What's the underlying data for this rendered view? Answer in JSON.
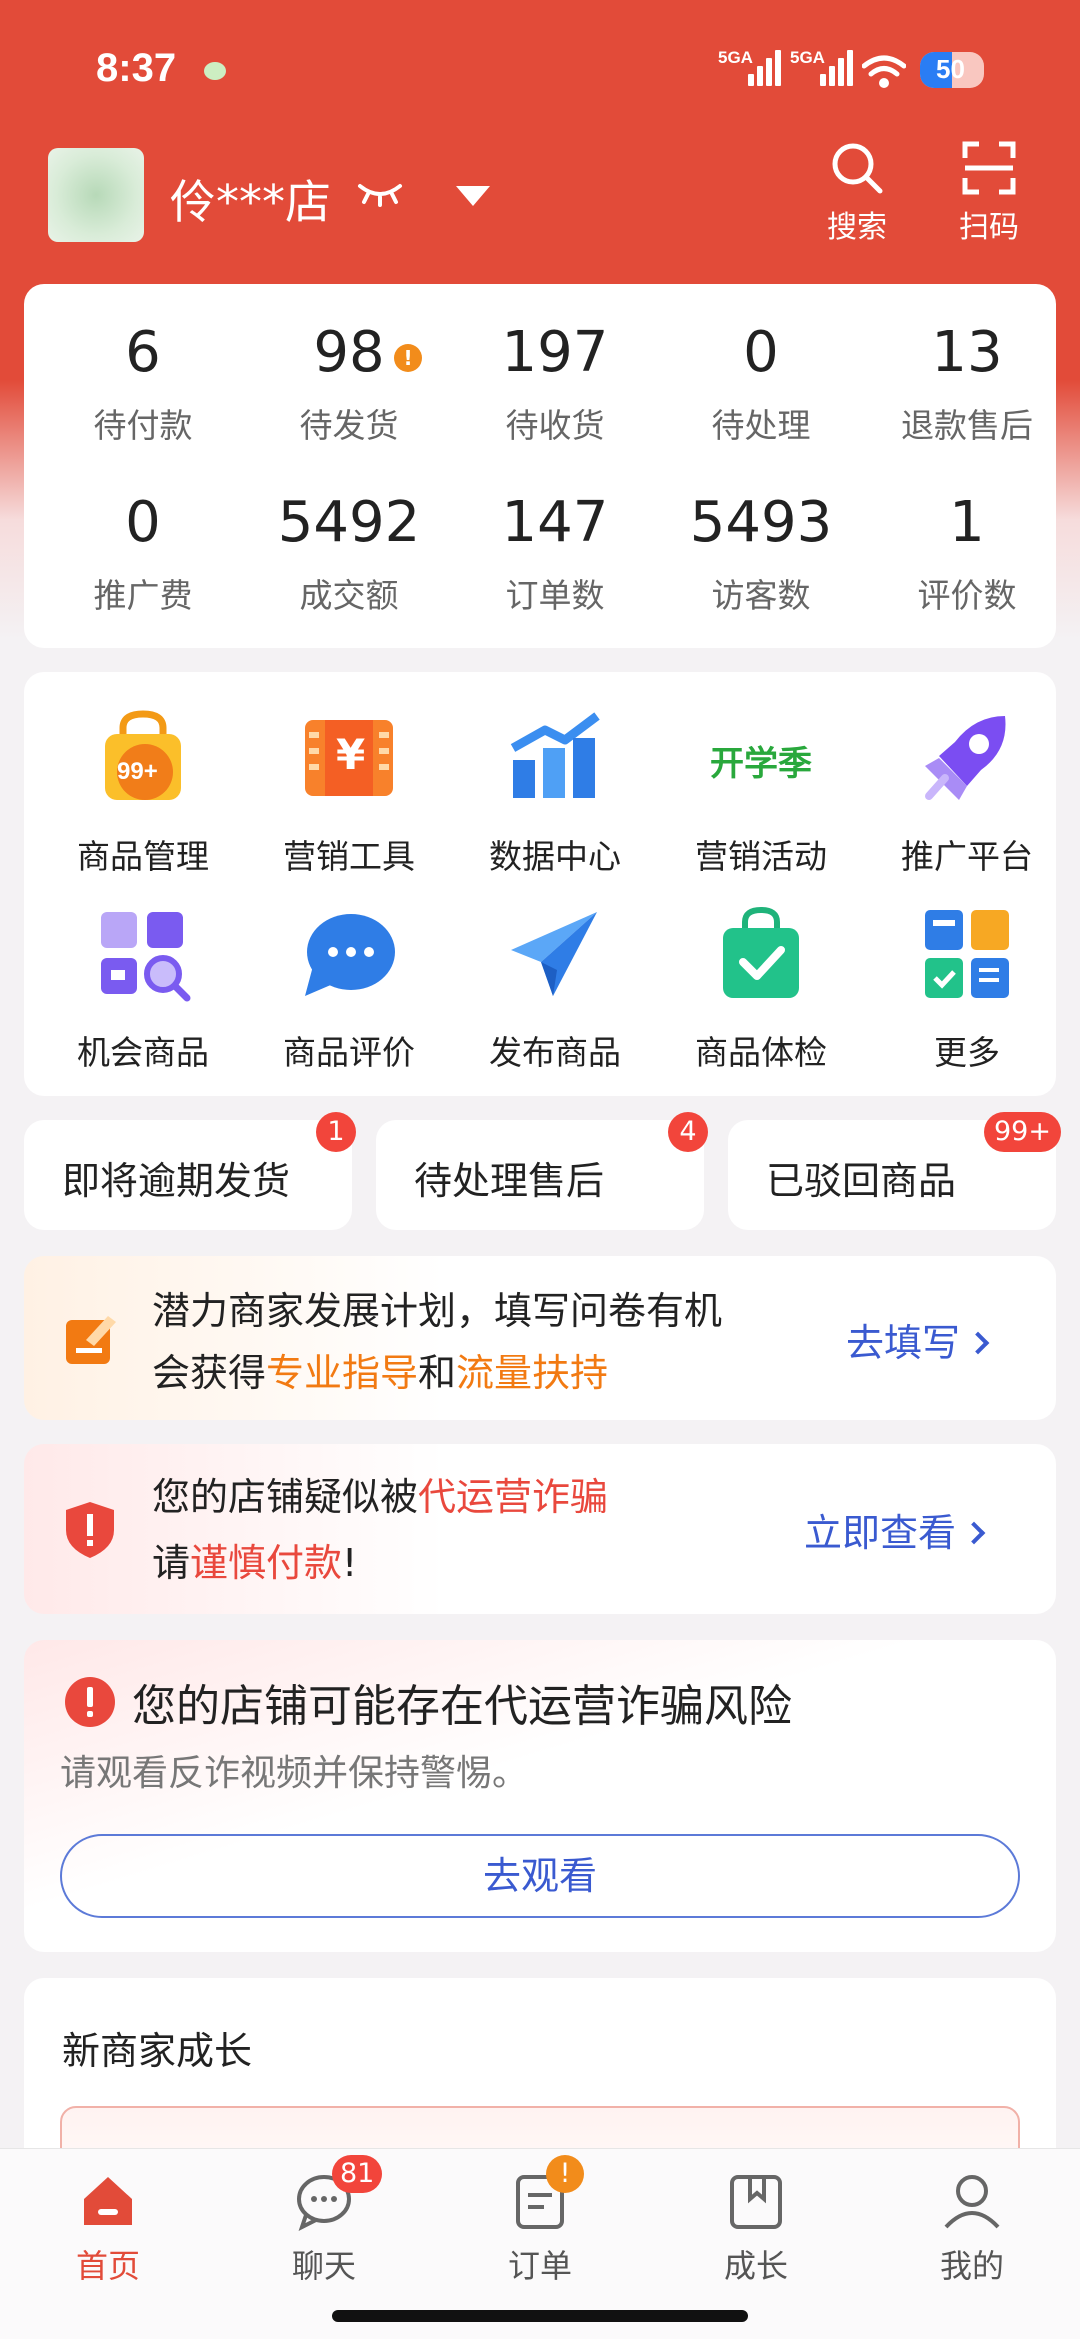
{
  "status_bar": {
    "time": "8:37",
    "network_1": "5GA",
    "network_2": "5GA",
    "battery": "50"
  },
  "header": {
    "shop_name": "伶***店",
    "search_label": "搜索",
    "scan_label": "扫码"
  },
  "stats": [
    {
      "value": "6",
      "label": "待付款"
    },
    {
      "value": "98",
      "label": "待发货",
      "alert": "!"
    },
    {
      "value": "197",
      "label": "待收货"
    },
    {
      "value": "0",
      "label": "待处理"
    },
    {
      "value": "13",
      "label": "退款售后"
    },
    {
      "value": "0",
      "label": "推广费"
    },
    {
      "value": "5492",
      "label": "成交额"
    },
    {
      "value": "147",
      "label": "订单数"
    },
    {
      "value": "5493",
      "label": "访客数"
    },
    {
      "value": "1",
      "label": "评价数"
    }
  ],
  "tools": [
    {
      "label": "商品管理",
      "icon": "shopping-bag-icon",
      "badge": "99+"
    },
    {
      "label": "营销工具",
      "icon": "coupon-icon",
      "glyph": "¥"
    },
    {
      "label": "数据中心",
      "icon": "bar-chart-icon"
    },
    {
      "label": "营销活动",
      "icon": "campaign-icon",
      "text": "开学季"
    },
    {
      "label": "推广平台",
      "icon": "rocket-icon"
    },
    {
      "label": "机会商品",
      "icon": "grid-search-icon"
    },
    {
      "label": "商品评价",
      "icon": "chat-bubble-icon"
    },
    {
      "label": "发布商品",
      "icon": "paper-plane-icon"
    },
    {
      "label": "商品体检",
      "icon": "check-bag-icon"
    },
    {
      "label": "更多",
      "icon": "more-apps-icon"
    }
  ],
  "pills": [
    {
      "label": "即将逾期发货",
      "badge": "1"
    },
    {
      "label": "待处理售后",
      "badge": "4"
    },
    {
      "label": "已驳回商品",
      "badge": "99+"
    }
  ],
  "plan_banner": {
    "line1": "潜力商家发展计划，填写问卷有机",
    "line2_a": "会获得",
    "line2_b": "专业指导",
    "line2_c": "和",
    "line2_d": "流量扶持",
    "link": "去填写"
  },
  "fraud_banner": {
    "line1_a": "您的店铺疑似被",
    "line1_b": "代运营诈骗",
    "line2_a": "请",
    "line2_b": "谨慎付款",
    "line2_c": "!",
    "link": "立即查看"
  },
  "risk_card": {
    "title": "您的店铺可能存在代运营诈骗风险",
    "subtitle": "请观看反诈视频并保持警惕。",
    "button": "去观看"
  },
  "growth_card": {
    "title": "新商家成长"
  },
  "bottom_nav": [
    {
      "label": "首页",
      "icon": "home-icon",
      "active": true
    },
    {
      "label": "聊天",
      "icon": "chat-icon",
      "badge": "81"
    },
    {
      "label": "订单",
      "icon": "order-icon",
      "badge": "!"
    },
    {
      "label": "成长",
      "icon": "book-icon"
    },
    {
      "label": "我的",
      "icon": "profile-icon"
    }
  ],
  "colors": {
    "brand_red": "#e24b39",
    "link_blue": "#3a5ad0",
    "highlight_orange": "#f27a12",
    "warning_red": "#e9483d"
  }
}
